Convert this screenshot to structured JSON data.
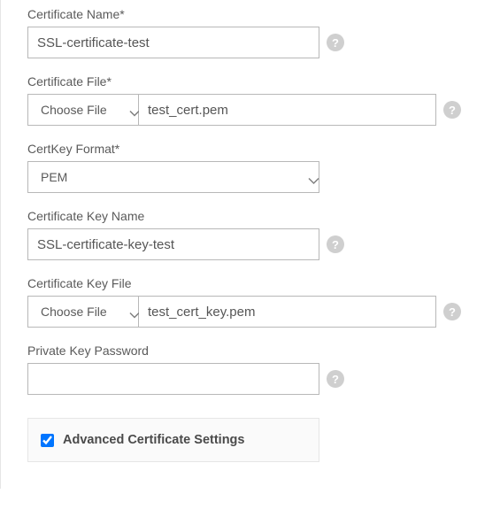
{
  "certName": {
    "label": "Certificate Name*",
    "value": "SSL-certificate-test"
  },
  "certFile": {
    "label": "Certificate File*",
    "chooseBtn": "Choose File",
    "fileName": "test_cert.pem"
  },
  "certKeyFormat": {
    "label": "CertKey Format*",
    "value": "PEM"
  },
  "certKeyName": {
    "label": "Certificate Key Name",
    "value": "SSL-certificate-key-test"
  },
  "certKeyFile": {
    "label": "Certificate Key File",
    "chooseBtn": "Choose File",
    "fileName": "test_cert_key.pem"
  },
  "privateKeyPwd": {
    "label": "Private Key Password",
    "value": ""
  },
  "advanced": {
    "label": "Advanced Certificate Settings",
    "checked": true
  },
  "helpGlyph": "?"
}
